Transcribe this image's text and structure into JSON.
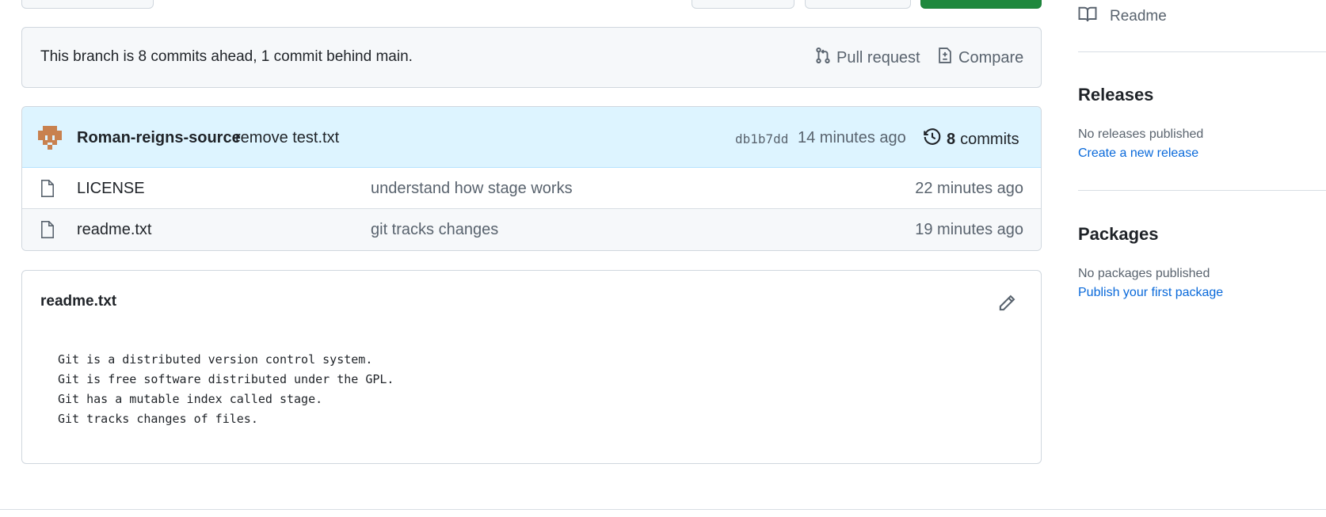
{
  "branch_info": {
    "text": "This branch is 8 commits ahead, 1 commit behind main.",
    "pull_request_label": "Pull request",
    "compare_label": "Compare"
  },
  "latest_commit": {
    "author": "Roman-reigns-source",
    "message": "remove test.txt",
    "sha": "db1b7dd",
    "time": "14 minutes ago",
    "commit_count": "8",
    "commits_label": "commits"
  },
  "files": [
    {
      "name": "LICENSE",
      "message": "understand how stage works",
      "time": "22 minutes ago",
      "icon": "file-icon"
    },
    {
      "name": "readme.txt",
      "message": "git tracks changes",
      "time": "19 minutes ago",
      "icon": "file-icon"
    }
  ],
  "readme": {
    "title": "readme.txt",
    "lines": [
      "Git is a distributed version control system.",
      "Git is free software distributed under the GPL.",
      "Git has a mutable index called stage.",
      "Git tracks changes of files."
    ]
  },
  "sidebar": {
    "readme_label": "Readme",
    "releases": {
      "heading": "Releases",
      "empty_text": "No releases published",
      "link": "Create a new release"
    },
    "packages": {
      "heading": "Packages",
      "empty_text": "No packages published",
      "link": "Publish your first package"
    }
  },
  "colors": {
    "accent_link": "#0969da",
    "commit_bar_bg": "#ddf4ff",
    "primary_button": "#1f883d",
    "muted_text": "#59636e"
  }
}
